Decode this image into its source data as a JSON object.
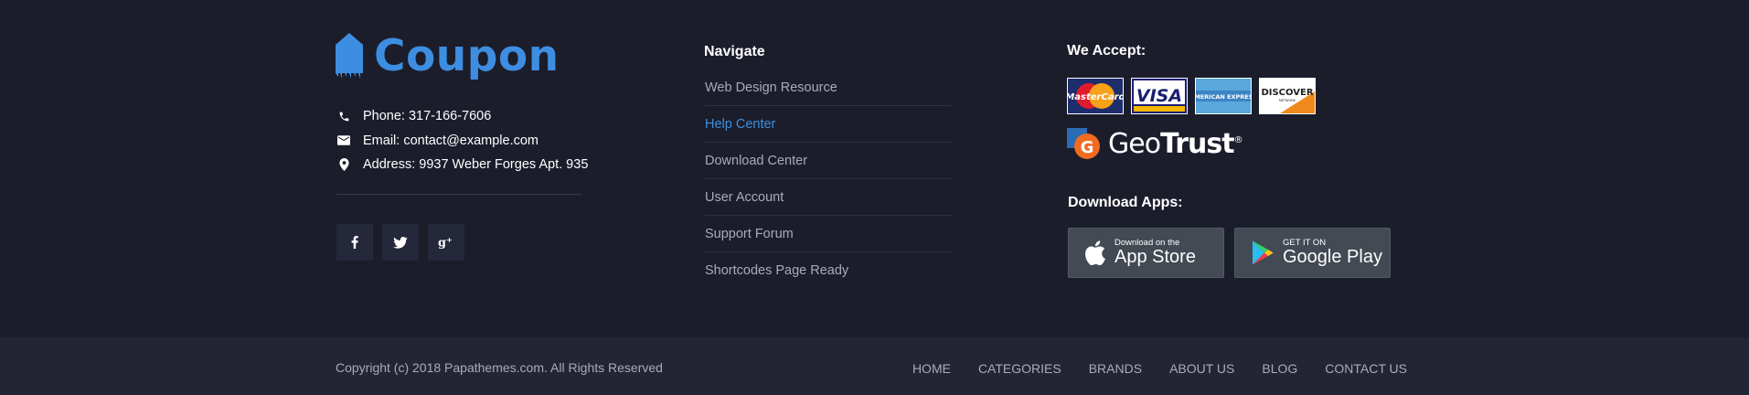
{
  "brand": {
    "name": "Coupon",
    "color": "#3d8ee0"
  },
  "contact": {
    "phone": "Phone: 317-166-7606",
    "email": "Email: contact@example.com",
    "address": "Address: 9937 Weber Forges Apt. 935"
  },
  "social": [
    {
      "icon": "facebook-icon",
      "glyph": "f"
    },
    {
      "icon": "twitter-icon",
      "glyph": "t"
    },
    {
      "icon": "google-plus-icon",
      "glyph": "g+"
    }
  ],
  "navigate": {
    "title": "Navigate",
    "items": [
      {
        "label": "Web Design Resource"
      },
      {
        "label": "Help Center",
        "active": true
      },
      {
        "label": "Download Center"
      },
      {
        "label": "User Account"
      },
      {
        "label": "Support Forum"
      },
      {
        "label": "Shortcodes Page Ready"
      }
    ]
  },
  "accept": {
    "title": "We Accept:",
    "cards": [
      {
        "name": "MasterCard"
      },
      {
        "name": "VISA"
      },
      {
        "name": "AMERICAN EXPRESS"
      },
      {
        "name": "DISCOVER",
        "sub": "NETWORK"
      }
    ],
    "geotrust": {
      "light": "Geo",
      "bold": "Trust",
      "mark": "®"
    }
  },
  "apps": {
    "title": "Download Apps:",
    "appstore": {
      "small": "Download on the",
      "big": "App Store"
    },
    "googleplay": {
      "small": "GET IT ON",
      "big": "Google Play"
    }
  },
  "bottom": {
    "copyright": "Copyright  (c) 2018 Papathemes.com. All Rights Reserved",
    "nav": [
      "HOME",
      "CATEGORIES",
      "BRANDS",
      "ABOUT US",
      "BLOG",
      "CONTACT US"
    ]
  }
}
